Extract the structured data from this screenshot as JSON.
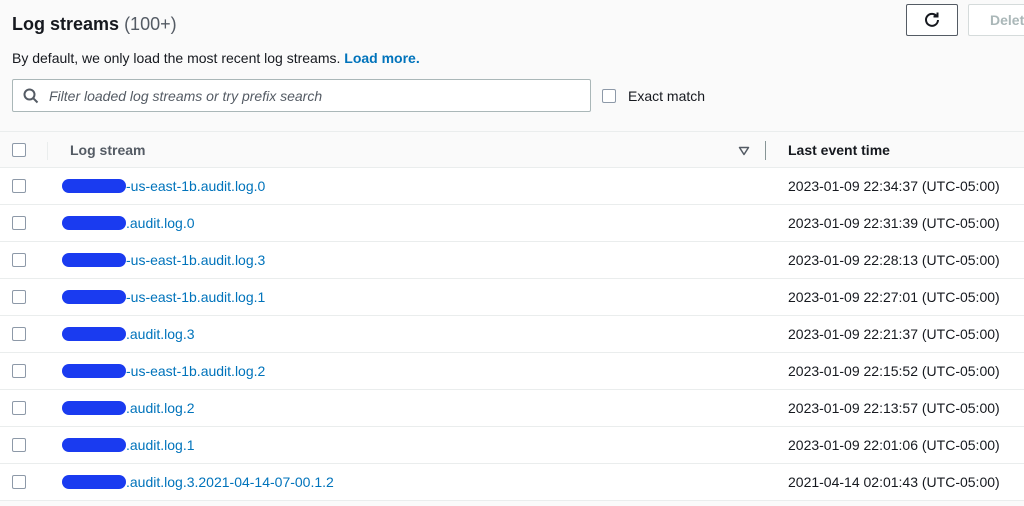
{
  "header": {
    "title": "Log streams",
    "count": "(100+)",
    "description": "By default, we only load the most recent log streams.",
    "load_more_link": "Load more."
  },
  "toolbar": {
    "refresh_icon": "refresh-icon",
    "delete_label": "Delete"
  },
  "search": {
    "placeholder": "Filter loaded log streams or try prefix search",
    "value": "",
    "icon": "search-icon"
  },
  "exact_match": {
    "label": "Exact match",
    "checked": false
  },
  "table": {
    "columns": [
      {
        "label": "Log stream",
        "sortable": true
      },
      {
        "label": "Last event time"
      }
    ],
    "rows": [
      {
        "stream_suffix": "-us-east-1b.audit.log.0",
        "last_event_time": "2023-01-09 22:34:37 (UTC-05:00)"
      },
      {
        "stream_suffix": ".audit.log.0",
        "last_event_time": "2023-01-09 22:31:39 (UTC-05:00)"
      },
      {
        "stream_suffix": "-us-east-1b.audit.log.3",
        "last_event_time": "2023-01-09 22:28:13 (UTC-05:00)"
      },
      {
        "stream_suffix": "-us-east-1b.audit.log.1",
        "last_event_time": "2023-01-09 22:27:01 (UTC-05:00)"
      },
      {
        "stream_suffix": ".audit.log.3",
        "last_event_time": "2023-01-09 22:21:37 (UTC-05:00)"
      },
      {
        "stream_suffix": "-us-east-1b.audit.log.2",
        "last_event_time": "2023-01-09 22:15:52 (UTC-05:00)"
      },
      {
        "stream_suffix": ".audit.log.2",
        "last_event_time": "2023-01-09 22:13:57 (UTC-05:00)"
      },
      {
        "stream_suffix": ".audit.log.1",
        "last_event_time": "2023-01-09 22:01:06 (UTC-05:00)"
      },
      {
        "stream_suffix": ".audit.log.3.2021-04-14-07-00.1.2",
        "last_event_time": "2021-04-14 02:01:43 (UTC-05:00)"
      }
    ]
  },
  "colors": {
    "link": "#0073bb",
    "redaction": "#1a3bf0",
    "text": "#16191f",
    "muted": "#545b64"
  }
}
